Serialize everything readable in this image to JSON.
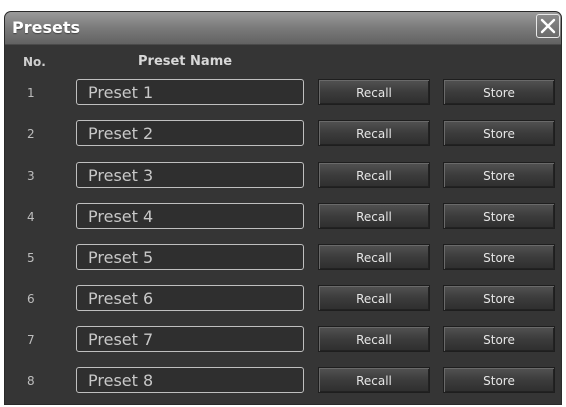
{
  "window": {
    "title": "Presets"
  },
  "headers": {
    "no": "No.",
    "name": "Preset Name"
  },
  "presets": [
    {
      "num": "1",
      "name": "Preset 1",
      "recall_label": "Recall",
      "store_label": "Store"
    },
    {
      "num": "2",
      "name": "Preset 2",
      "recall_label": "Recall",
      "store_label": "Store"
    },
    {
      "num": "3",
      "name": "Preset 3",
      "recall_label": "Recall",
      "store_label": "Store"
    },
    {
      "num": "4",
      "name": "Preset 4",
      "recall_label": "Recall",
      "store_label": "Store"
    },
    {
      "num": "5",
      "name": "Preset 5",
      "recall_label": "Recall",
      "store_label": "Store"
    },
    {
      "num": "6",
      "name": "Preset 6",
      "recall_label": "Recall",
      "store_label": "Store"
    },
    {
      "num": "7",
      "name": "Preset 7",
      "recall_label": "Recall",
      "store_label": "Store"
    },
    {
      "num": "8",
      "name": "Preset 8",
      "recall_label": "Recall",
      "store_label": "Store"
    }
  ],
  "icons": {
    "close": "close-icon"
  }
}
